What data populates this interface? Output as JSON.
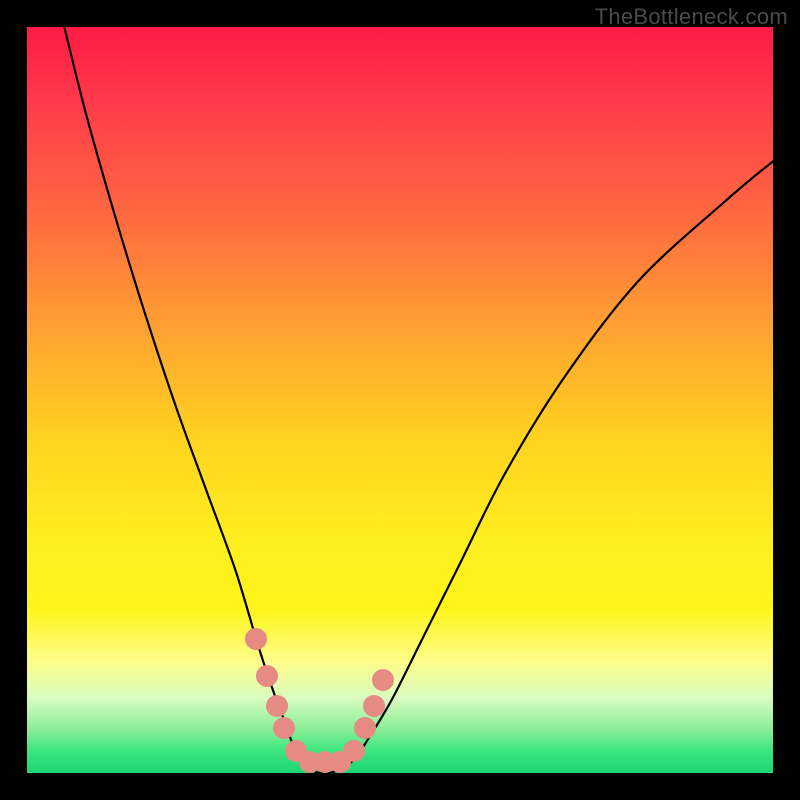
{
  "watermark": {
    "text": "TheBottleneck.com"
  },
  "colors": {
    "frame": "#000000",
    "gradient_stops": [
      "#ff1a45",
      "#ff3a4a",
      "#ff6840",
      "#ffa033",
      "#ffd21f",
      "#ffed20",
      "#fff51a",
      "#fdfd8a",
      "#d8fcc0",
      "#8def98",
      "#3de680",
      "#1bd672"
    ],
    "curve": "#000000",
    "marker": "#e58b83",
    "watermark": "#4a4a4a"
  },
  "chart_data": {
    "type": "line",
    "title": "",
    "xlabel": "",
    "ylabel": "",
    "xlim": [
      0,
      100
    ],
    "ylim": [
      0,
      100
    ],
    "grid": false,
    "legend": false,
    "series": [
      {
        "name": "curve",
        "x": [
          5,
          8,
          12,
          16,
          20,
          24,
          28,
          31,
          33,
          34.5,
          36,
          38,
          40,
          42,
          44,
          46,
          49,
          53,
          58,
          64,
          72,
          82,
          94,
          100
        ],
        "y": [
          100,
          88,
          74,
          61,
          49,
          38,
          27,
          17,
          11,
          7,
          3,
          0.5,
          0,
          0.5,
          2,
          5,
          10,
          18,
          28,
          40,
          53,
          66,
          77,
          82
        ]
      }
    ],
    "markers": {
      "name": "highlight-points",
      "color": "#e58b83",
      "x": [
        30.7,
        32.2,
        33.5,
        34.5,
        36.0,
        38.0,
        40.0,
        42.0,
        43.8,
        45.3,
        46.5,
        47.7
      ],
      "y": [
        18.0,
        13.0,
        9.0,
        6.0,
        3.0,
        1.5,
        1.5,
        1.5,
        3.0,
        6.0,
        9.0,
        12.5
      ]
    }
  }
}
